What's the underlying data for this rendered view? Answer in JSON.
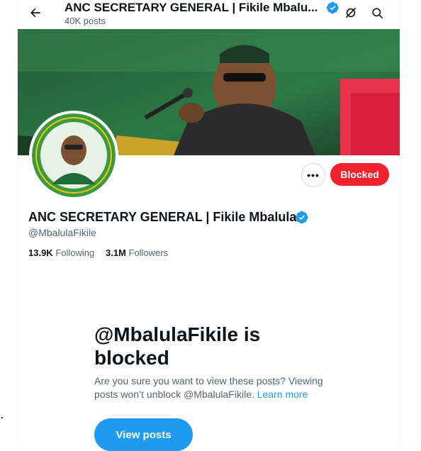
{
  "header": {
    "title": "ANC SECRETARY GENERAL | Fikile Mbalu...",
    "posts_count": "40K posts"
  },
  "profile": {
    "name": "ANC SECRETARY GENERAL | Fikile Mbalula",
    "handle": "@MbalulaFikile",
    "following_count": "13.9K",
    "following_label": "Following",
    "followers_count": "3.1M",
    "followers_label": "Followers",
    "blocked_button": "Blocked",
    "more_button": "•••"
  },
  "blocked_notice": {
    "title": "@MbalulaFikile is blocked",
    "text": "Are you sure you want to view these posts? Viewing posts won’t unblock @MbalulaFikile.",
    "learn_more": "Learn more",
    "view_button": "View posts"
  },
  "avatar": {
    "ring_text": "I AM VOTING ANC | 29 MAY 2024"
  },
  "colors": {
    "accent": "#1d9bf0",
    "blocked": "#f4212e",
    "verified": "#1d9bf0"
  }
}
